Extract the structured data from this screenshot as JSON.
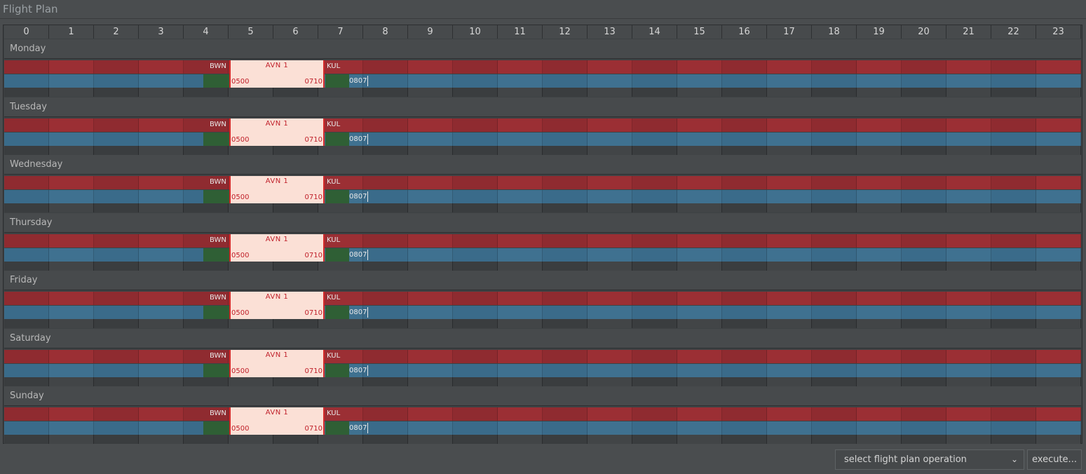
{
  "window": {
    "title": "Flight Plan"
  },
  "hours": [
    "0",
    "1",
    "2",
    "3",
    "4",
    "5",
    "6",
    "7",
    "8",
    "9",
    "10",
    "11",
    "12",
    "13",
    "14",
    "15",
    "16",
    "17",
    "18",
    "19",
    "20",
    "21",
    "22",
    "23"
  ],
  "days": [
    {
      "name": "Monday",
      "flight": {
        "from": "BWN",
        "to": "KUL",
        "number": "AVN 1",
        "dep": "0500",
        "arr": "0710",
        "next": "0807"
      }
    },
    {
      "name": "Tuesday",
      "flight": {
        "from": "BWN",
        "to": "KUL",
        "number": "AVN 1",
        "dep": "0500",
        "arr": "0710",
        "next": "0807"
      }
    },
    {
      "name": "Wednesday",
      "flight": {
        "from": "BWN",
        "to": "KUL",
        "number": "AVN 1",
        "dep": "0500",
        "arr": "0710",
        "next": "0807"
      }
    },
    {
      "name": "Thursday",
      "flight": {
        "from": "BWN",
        "to": "KUL",
        "number": "AVN 1",
        "dep": "0500",
        "arr": "0710",
        "next": "0807"
      }
    },
    {
      "name": "Friday",
      "flight": {
        "from": "BWN",
        "to": "KUL",
        "number": "AVN 1",
        "dep": "0500",
        "arr": "0710",
        "next": "0807"
      }
    },
    {
      "name": "Saturday",
      "flight": {
        "from": "BWN",
        "to": "KUL",
        "number": "AVN 1",
        "dep": "0500",
        "arr": "0710",
        "next": "0807"
      }
    },
    {
      "name": "Sunday",
      "flight": {
        "from": "BWN",
        "to": "KUL",
        "number": "AVN 1",
        "dep": "0500",
        "arr": "0710",
        "next": "0807"
      }
    }
  ],
  "footer": {
    "operation_select": "select flight plan operation",
    "execute_label": "execute..."
  },
  "colors": {
    "lane_red": "#8f2b30",
    "lane_blue": "#3a6b8a",
    "ground": "#2f5f35",
    "flight_block": "#fbe0d6",
    "flight_text": "#c0202a"
  },
  "icons": {
    "dropdown": "chevron-down-icon"
  }
}
